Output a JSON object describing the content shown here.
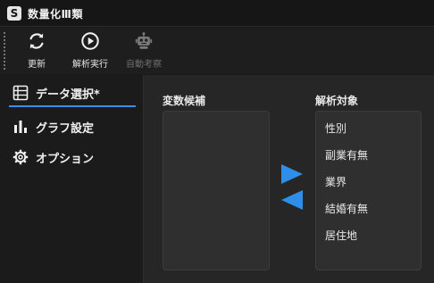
{
  "window": {
    "title": "数量化Ⅲ類",
    "app_icon_letter": "S"
  },
  "toolbar": {
    "refresh_label": "更新",
    "run_label": "解析実行",
    "auto_label": "自動考察"
  },
  "sidebar": {
    "items": [
      {
        "label": "データ選択*",
        "icon": "table-icon"
      },
      {
        "label": "グラフ設定",
        "icon": "bar-chart-icon"
      },
      {
        "label": "オプション",
        "icon": "gear-icon"
      }
    ]
  },
  "main": {
    "candidates_label": "変数候補",
    "targets_label": "解析対象",
    "target_items": [
      "性別",
      "副業有無",
      "業界",
      "結婚有無",
      "居住地"
    ]
  },
  "colors": {
    "accent": "#3a8ee6",
    "arrow": "#2f8fe8"
  }
}
